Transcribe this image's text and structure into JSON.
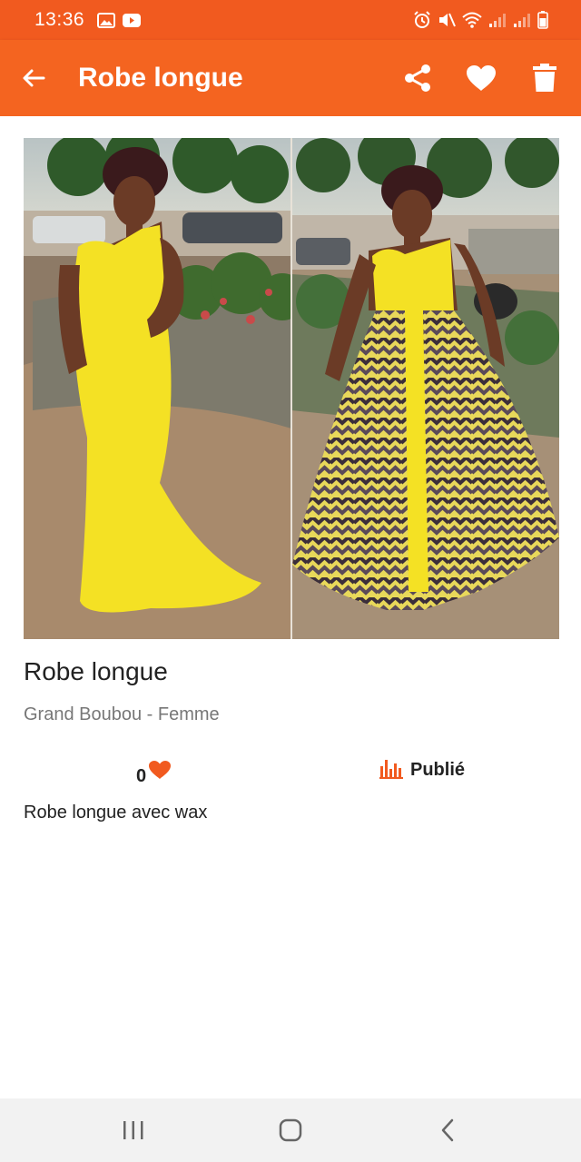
{
  "status_bar": {
    "time": "13:36",
    "left_icons": [
      "image-icon",
      "youtube-icon"
    ],
    "right_icons": [
      "alarm-icon",
      "mute-icon",
      "wifi-icon",
      "signal-icon",
      "signal-icon",
      "battery-icon"
    ]
  },
  "app_bar": {
    "title": "Robe longue",
    "background": "#f46420",
    "actions": [
      "share-icon",
      "heart-icon",
      "trash-icon"
    ]
  },
  "item": {
    "title": "Robe longue",
    "category": "Grand Boubou - Femme",
    "likes": "0",
    "status": "Publié",
    "description": "Robe longue avec wax",
    "accent": "#f15a1f"
  },
  "nav_bar": {
    "buttons": [
      "recents-icon",
      "home-icon",
      "back-icon"
    ]
  }
}
